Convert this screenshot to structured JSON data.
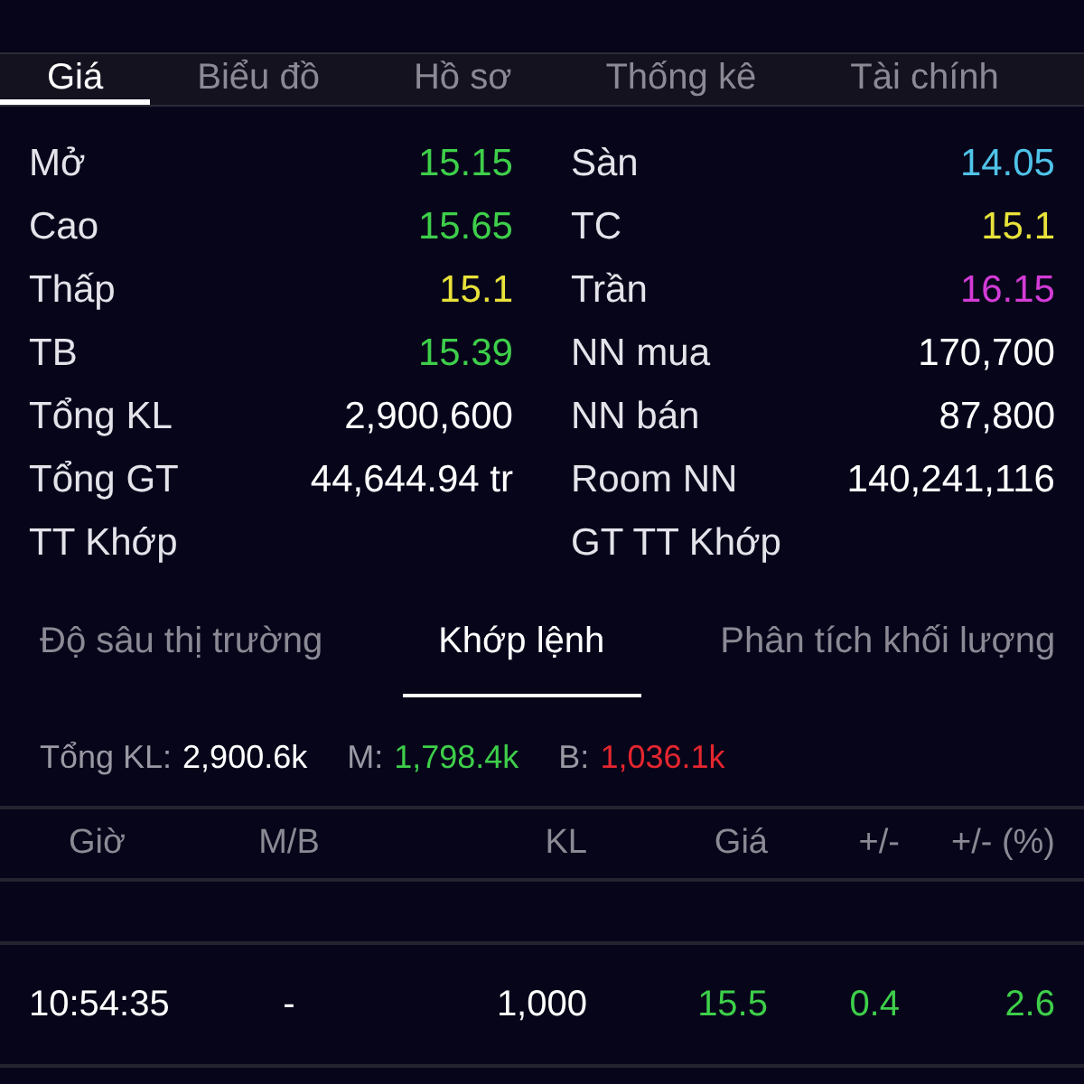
{
  "tabs": [
    {
      "label": "Giá",
      "selected": true
    },
    {
      "label": "Biểu đồ",
      "selected": false
    },
    {
      "label": "Hồ sơ",
      "selected": false
    },
    {
      "label": "Thống kê",
      "selected": false
    },
    {
      "label": "Tài chính",
      "selected": false
    }
  ],
  "stats": [
    {
      "label": "Mở",
      "value": "15.15",
      "color": "#3ecf4a"
    },
    {
      "label": "Sàn",
      "value": "14.05",
      "color": "#4fc3e8"
    },
    {
      "label": "Cao",
      "value": "15.65",
      "color": "#3ecf4a"
    },
    {
      "label": "TC",
      "value": "15.1",
      "color": "#e8e23a"
    },
    {
      "label": "Thấp",
      "value": "15.1",
      "color": "#e8e23a"
    },
    {
      "label": "Trần",
      "value": "16.15",
      "color": "#d33bd6"
    },
    {
      "label": "TB",
      "value": "15.39",
      "color": "#3ecf4a"
    },
    {
      "label": "NN mua",
      "value": "170,700",
      "color": "#ffffff"
    },
    {
      "label": "Tổng KL",
      "value": "2,900,600",
      "color": "#ffffff"
    },
    {
      "label": "NN bán",
      "value": "87,800",
      "color": "#ffffff"
    },
    {
      "label": "Tổng GT",
      "value": "44,644.94 tr",
      "color": "#ffffff"
    },
    {
      "label": "Room NN",
      "value": "140,241,116",
      "color": "#ffffff"
    },
    {
      "label": "TT Khớp"
    },
    {
      "label": "GT TT Khớp"
    }
  ],
  "sub_tabs": [
    {
      "label": "Độ sâu thị trường",
      "selected": false
    },
    {
      "label": "Khớp lệnh",
      "selected": true
    },
    {
      "label": "Phân tích khối lượng",
      "selected": false
    }
  ],
  "summary": [
    {
      "label": "Tổng KL:",
      "value": "2,900.6k",
      "color": "#ffffff"
    },
    {
      "label": "M:",
      "value": "1,798.4k",
      "color": "#3ecf4a"
    },
    {
      "label": "B:",
      "value": "1,036.1k",
      "color": "#e5262f"
    }
  ],
  "table": {
    "columns": [
      "Giờ",
      "M/B",
      "KL",
      "Giá",
      "+/-",
      "+/- (%)"
    ],
    "rows": [
      {
        "cells": [
          "10:54:35",
          "-",
          "1,000",
          "15.5",
          "0.4",
          "2.6"
        ],
        "color": "#3ecf4a"
      }
    ]
  }
}
